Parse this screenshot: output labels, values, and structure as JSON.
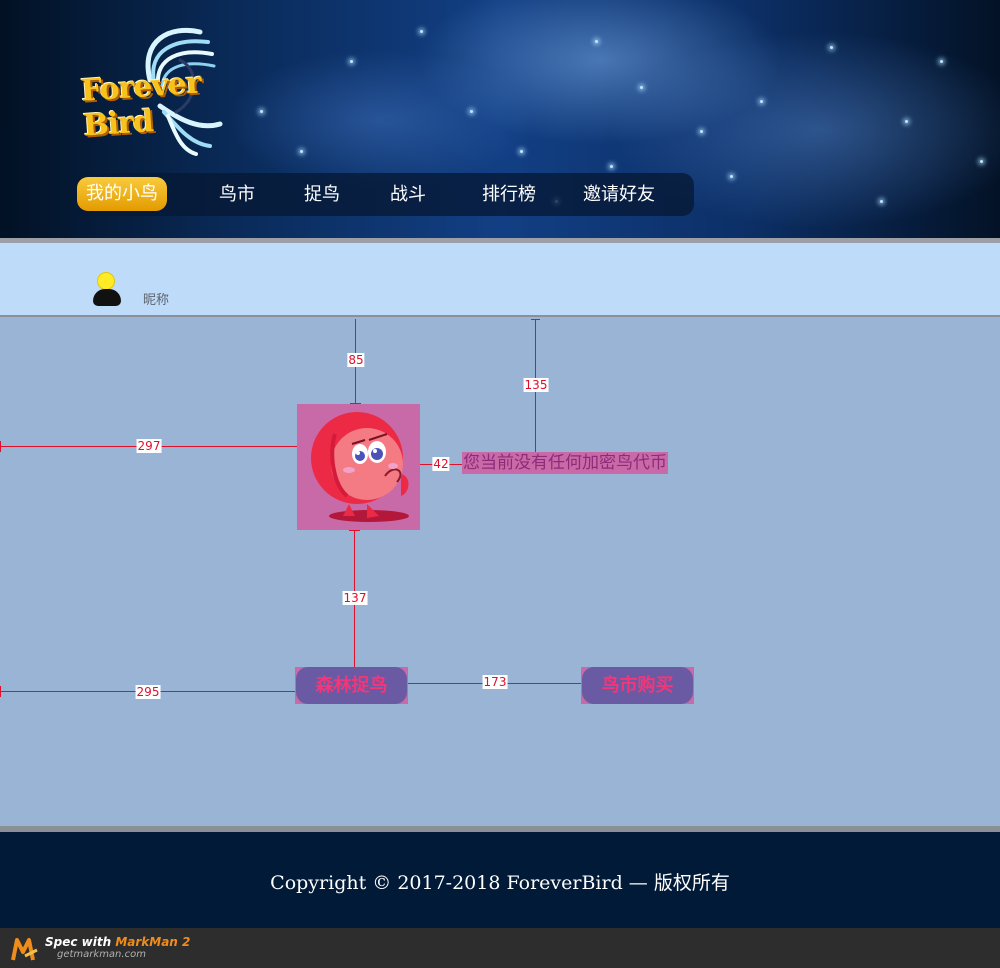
{
  "brand": {
    "logo_text": "Forever Bird"
  },
  "nav": {
    "items": [
      "我的小鸟",
      "鸟市",
      "捉鸟",
      "战斗",
      "排行榜",
      "邀请好友"
    ],
    "active_index": 0
  },
  "user": {
    "nickname": "昵称"
  },
  "main": {
    "empty_message": "您当前没有任何加密鸟代币",
    "forest_catch_label": "森林捉鸟",
    "market_buy_label": "鸟市购买"
  },
  "measurements": [
    "85",
    "135",
    "297",
    "42",
    "137",
    "295",
    "173"
  ],
  "footer": {
    "copyright": "Copyright © 2017-2018 ForeverBird — 版权所有"
  },
  "markman": {
    "spec_prefix": "Spec with ",
    "brand": "MarkMan 2",
    "url": "getmarkman.com"
  },
  "colors": {
    "header_dark": "#021124",
    "nav_active": "#f4b31c",
    "user_bar": "#bfdbfa",
    "main_bg": "#9ab4d6",
    "footer_bg": "#001a38",
    "measure_red": "#e0102a",
    "highlight_pink": "#c96aa8"
  }
}
